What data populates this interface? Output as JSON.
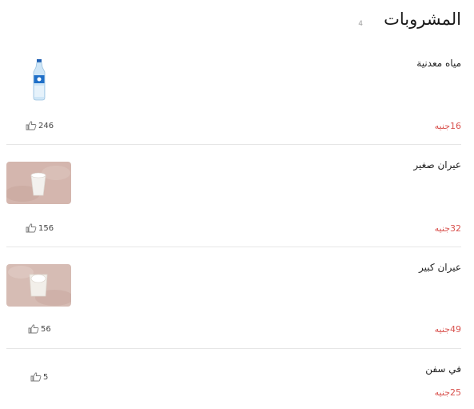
{
  "section": {
    "title": "المشروبات",
    "count": "4"
  },
  "currency": "جنيه",
  "items": [
    {
      "name": "مياه معدنية",
      "price": "16",
      "price_unit": "جنيه",
      "likes": "246",
      "image": "water-bottle-image"
    },
    {
      "name": "عيران صغير",
      "price": "32",
      "price_unit": "جنيه",
      "likes": "156",
      "image": "small-ayran-cup-image"
    },
    {
      "name": "عيران كبير",
      "price": "49",
      "price_unit": "جنيه",
      "likes": "56",
      "image": "large-ayran-cup-image"
    },
    {
      "name": "في سفن",
      "price": "25",
      "price_unit": "جنيه",
      "likes": "5",
      "image": ""
    }
  ],
  "icons": {
    "like": "thumbs-up-icon"
  },
  "colors": {
    "price": "#d9534f",
    "divider": "#e6e6e6"
  }
}
